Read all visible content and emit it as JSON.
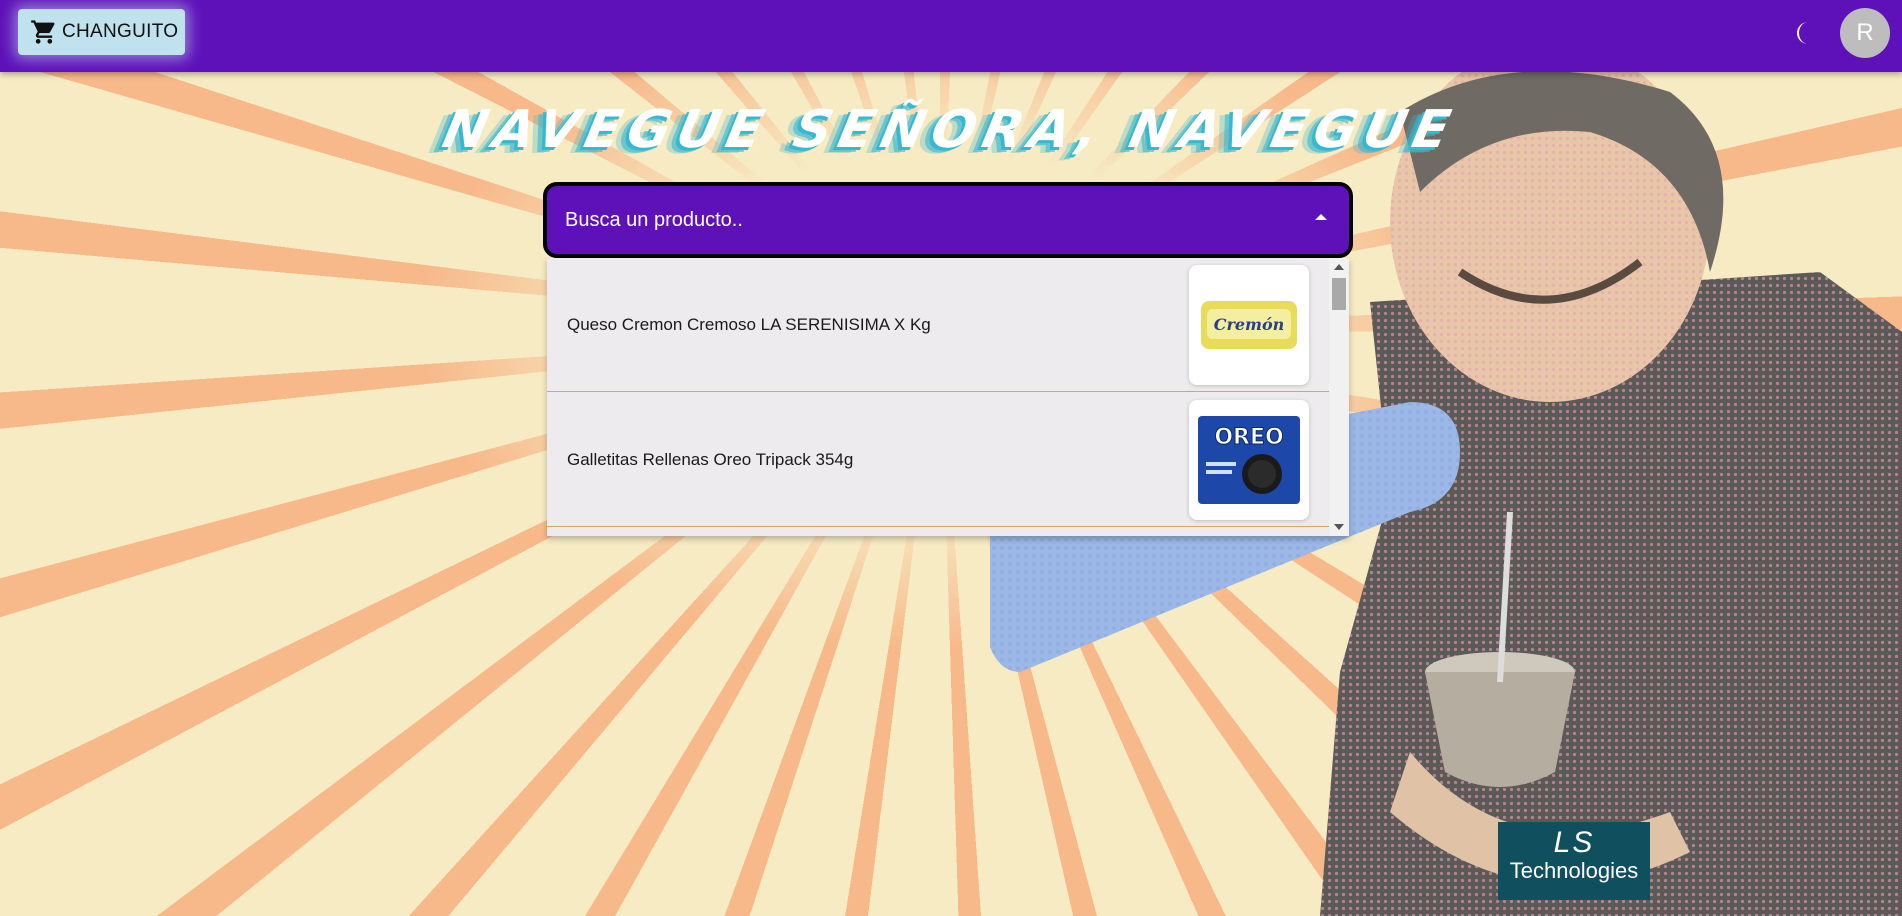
{
  "appbar": {
    "cart_label": "CHANGUITO",
    "avatar_initial": "R",
    "color": "#5f11b9"
  },
  "heading": "NAVEGUE SEÑORA, NAVEGUE",
  "search": {
    "placeholder": "Busca un producto.."
  },
  "results": [
    {
      "label": "Queso Cremon Cremoso LA SERENISIMA X Kg",
      "image_text": "Cremón"
    },
    {
      "label": "Galletitas Rellenas Oreo Tripack 354g",
      "image_text": "OREO"
    }
  ],
  "logo": {
    "top": "LS",
    "bottom": "Technologies"
  }
}
